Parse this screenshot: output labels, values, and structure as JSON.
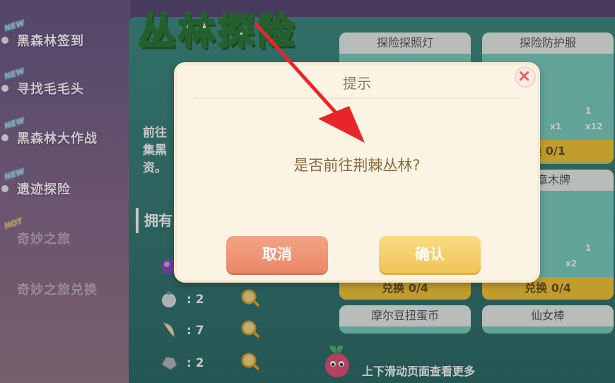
{
  "left_menu": {
    "items": [
      {
        "tag": "NEW",
        "label": "黑森林签到"
      },
      {
        "tag": "NEW",
        "label": "寻找毛毛头"
      },
      {
        "tag": "NEW",
        "label": "黑森林大作战"
      },
      {
        "tag": "NEW",
        "label": "遗迹探险"
      },
      {
        "tag": "HOT",
        "label": "奇妙之旅"
      },
      {
        "tag": "",
        "label": "奇妙之旅兑换"
      }
    ]
  },
  "main": {
    "logo_title": "丛林探险",
    "intro_text": "前往集黑资。",
    "owned_heading": "拥有",
    "resources": [
      {
        "icon": "purple-gem-icon",
        "count": ""
      },
      {
        "icon": "bomb-icon",
        "count": ": 2"
      },
      {
        "icon": "fang-icon",
        "count": ": 7"
      },
      {
        "icon": "stone-icon",
        "count": ": 2"
      }
    ],
    "scroll_hint": "上下滑动页面查看更多"
  },
  "shop": {
    "cards": [
      {
        "title": "探险探照灯",
        "cost": "",
        "button": ""
      },
      {
        "title": "探险防护服",
        "costs": [
          "x1",
          "x12"
        ],
        "stock": "1",
        "button": "换 0/1"
      },
      {
        "title": "",
        "cost": "",
        "button": "兑换 0/4"
      },
      {
        "title": "奖章木牌",
        "costs": [
          "x2"
        ],
        "stock": "1",
        "button": "兑换 0/4"
      },
      {
        "title": "摩尔豆扭蛋币",
        "button": ""
      },
      {
        "title": "仙女棒",
        "button": ""
      }
    ]
  },
  "dialog": {
    "title": "提示",
    "message": "是否前往荆棘丛林?",
    "cancel_label": "取消",
    "confirm_label": "确认"
  },
  "colors": {
    "cancel": "#ea8866",
    "confirm": "#f2c458",
    "arrow": "#e8262a",
    "exchange": "#f6c93a"
  }
}
